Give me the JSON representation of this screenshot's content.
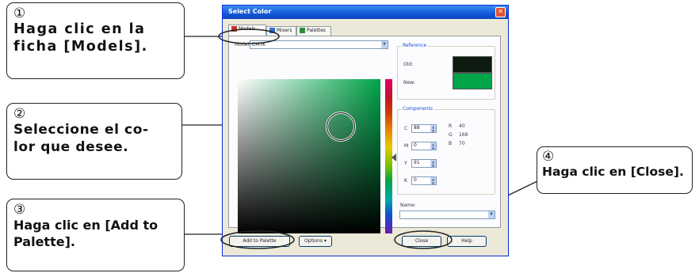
{
  "callouts": {
    "c1": {
      "num": "①",
      "text": "Haga clic en la\nficha [Models]."
    },
    "c2": {
      "num": "②",
      "text": "Seleccione el co-\nlor que desee."
    },
    "c3": {
      "num": "③",
      "text": "Haga clic en [Add to\nPalette]."
    },
    "c4": {
      "num": "④",
      "text": "Haga clic en [Close]."
    }
  },
  "dialog": {
    "title": "Select Color",
    "close_glyph": "✕",
    "tabs": [
      {
        "label": "Models",
        "icon": "models-icon",
        "color": "#c0392b"
      },
      {
        "label": "Mixers",
        "icon": "mixers-icon",
        "color": "#2d6fd1"
      },
      {
        "label": "Palettes",
        "icon": "palettes-icon",
        "color": "#2e8b3e"
      }
    ],
    "model_label": "Model:",
    "model_value": "CMYK",
    "reference": {
      "title": "Reference",
      "old_label": "Old:",
      "new_label": "New:",
      "old_color": "#0d1a10",
      "new_color": "#00a54a"
    },
    "components": {
      "title": "Components",
      "cmyk": [
        {
          "label": "C",
          "value": "88"
        },
        {
          "label": "M",
          "value": "0"
        },
        {
          "label": "Y",
          "value": "91"
        },
        {
          "label": "K",
          "value": "0"
        }
      ],
      "rgb": [
        {
          "label": "R",
          "value": "40"
        },
        {
          "label": "G",
          "value": "169"
        },
        {
          "label": "B",
          "value": "70"
        }
      ]
    },
    "name_label": "Name:",
    "buttons": {
      "add_to_palette": "Add to Palette",
      "options": "Options",
      "close": "Close",
      "help": "Help"
    }
  }
}
